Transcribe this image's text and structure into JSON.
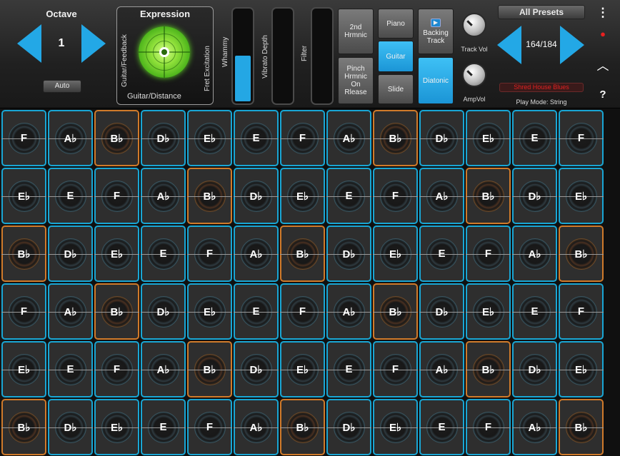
{
  "octave": {
    "title": "Octave",
    "value": "1",
    "auto_label": "Auto"
  },
  "expression": {
    "title": "Expression",
    "left_label": "Guitar/Feedback",
    "right_label": "Fret Excitation",
    "bottom_label": "Guitar/Distance"
  },
  "sliders": [
    {
      "label": "Whammy",
      "level": 0.5
    },
    {
      "label": "Vibrato Depth",
      "level": 0
    },
    {
      "label": "Filter",
      "level": 0
    }
  ],
  "buttons": {
    "second_harmonic": "2nd Hrmnic",
    "pinch_harmonic": "Pinch Hrmnic On Rlease",
    "piano": "Piano",
    "guitar": "Guitar",
    "slide": "Slide",
    "backing_track": "Backing Track",
    "diatonic": "Diatonic"
  },
  "knobs": {
    "track_vol": "Track Vol",
    "amp_vol": "AmpVol"
  },
  "presets": {
    "title": "All Presets",
    "counter": "164/184",
    "name": "Shred House Blues",
    "play_mode": "Play Mode: String"
  },
  "colors": {
    "accent": "#23a8e6",
    "grid_border": "#19a6d4",
    "root_border": "#d07a2a",
    "preset_name": "#e02020"
  },
  "icons": {
    "menu": "vertical-dots-icon",
    "record": "record-icon",
    "collapse": "chevron-up-icon",
    "help": "question-icon"
  },
  "side_labels": {
    "help": "?"
  },
  "grid": [
    [
      "F",
      "A♭",
      "B♭",
      "D♭",
      "E♭",
      "E",
      "F",
      "A♭",
      "B♭",
      "D♭",
      "E♭",
      "E",
      "F"
    ],
    [
      "E♭",
      "E",
      "F",
      "A♭",
      "B♭",
      "D♭",
      "E♭",
      "E",
      "F",
      "A♭",
      "B♭",
      "D♭",
      "E♭"
    ],
    [
      "B♭",
      "D♭",
      "E♭",
      "E",
      "F",
      "A♭",
      "B♭",
      "D♭",
      "E♭",
      "E",
      "F",
      "A♭",
      "B♭"
    ],
    [
      "F",
      "A♭",
      "B♭",
      "D♭",
      "E♭",
      "E",
      "F",
      "A♭",
      "B♭",
      "D♭",
      "E♭",
      "E",
      "F"
    ],
    [
      "E♭",
      "E",
      "F",
      "A♭",
      "B♭",
      "D♭",
      "E♭",
      "E",
      "F",
      "A♭",
      "B♭",
      "D♭",
      "E♭"
    ],
    [
      "B♭",
      "D♭",
      "E♭",
      "E",
      "F",
      "A♭",
      "B♭",
      "D♭",
      "E♭",
      "E",
      "F",
      "A♭",
      "B♭"
    ]
  ],
  "root_note": "B♭"
}
